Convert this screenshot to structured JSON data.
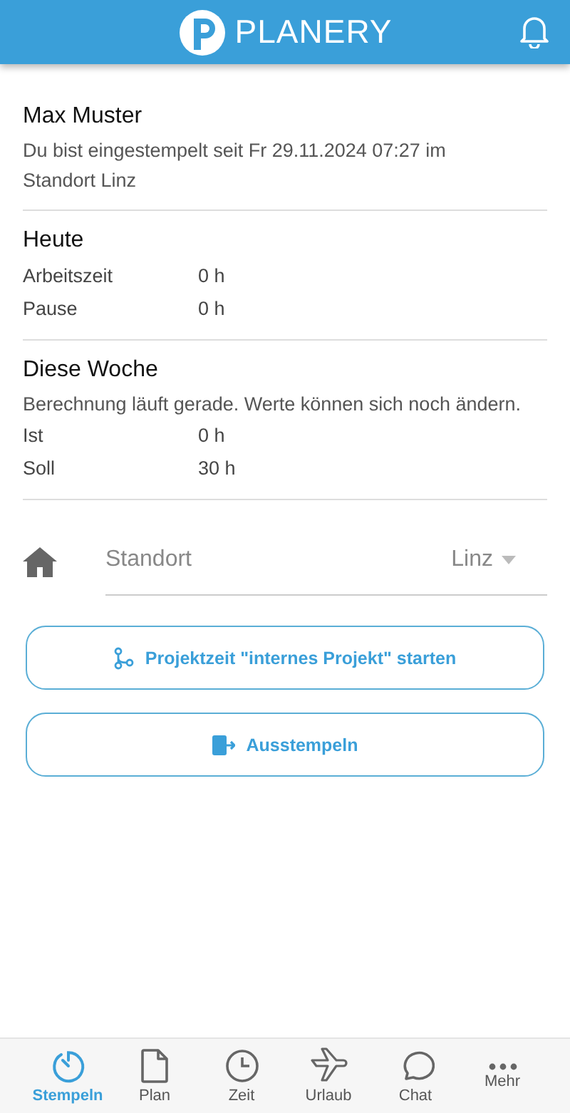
{
  "header": {
    "title": "PLANERY"
  },
  "user": {
    "name": "Max Muster",
    "status": "Du bist eingestempelt seit Fr 29.11.2024 07:27 im Standort Linz"
  },
  "sections": [
    {
      "title": "Heute",
      "rows": [
        {
          "label": "Arbeitszeit",
          "value": "0 h"
        },
        {
          "label": "Pause",
          "value": "0 h"
        }
      ]
    },
    {
      "title": "Diese Woche",
      "note": "Berechnung läuft gerade. Werte können sich noch ändern.",
      "rows": [
        {
          "label": "Ist",
          "value": "0 h"
        },
        {
          "label": "Soll",
          "value": "30 h"
        }
      ]
    }
  ],
  "location": {
    "label": "Standort",
    "value": "Linz"
  },
  "actions": [
    {
      "label": "Projektzeit \"internes Projekt\" starten"
    },
    {
      "label": "Ausstempeln"
    }
  ],
  "nav": [
    {
      "label": "Stempeln",
      "selected": true
    },
    {
      "label": "Plan",
      "selected": false
    },
    {
      "label": "Zeit",
      "selected": false
    },
    {
      "label": "Urlaub",
      "selected": false
    },
    {
      "label": "Chat",
      "selected": false
    },
    {
      "label": "Mehr",
      "selected": false
    }
  ]
}
